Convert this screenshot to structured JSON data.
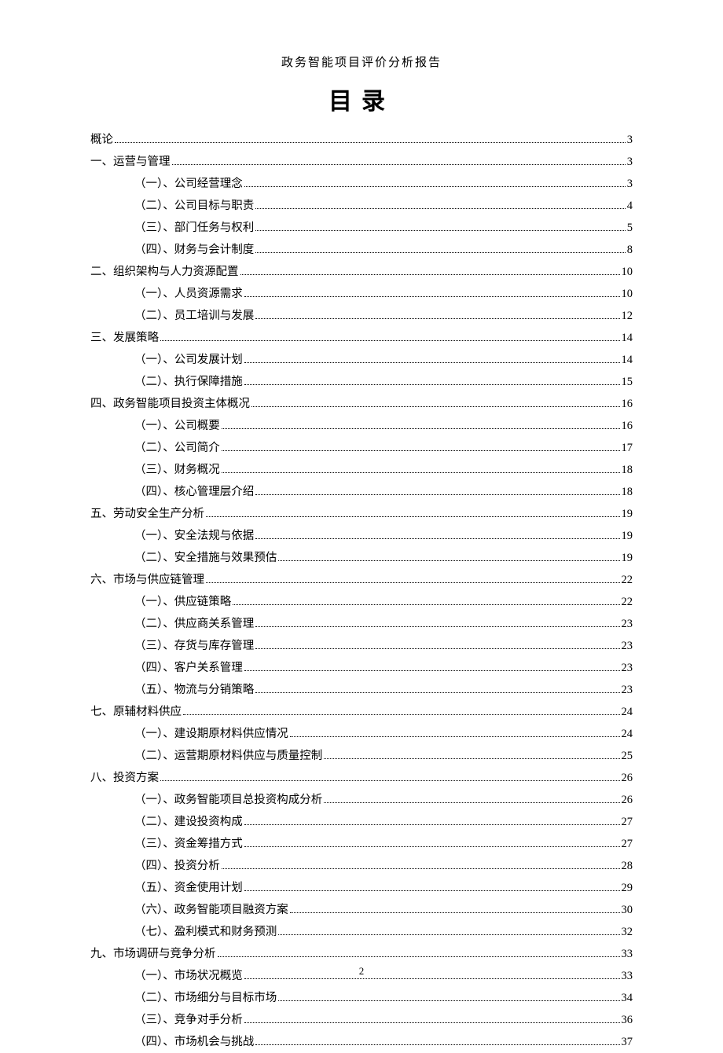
{
  "header": "政务智能项目评价分析报告",
  "title": "目录",
  "page_number": "2",
  "toc": [
    {
      "level": 0,
      "label": "概论",
      "page": "3"
    },
    {
      "level": 0,
      "label": "一、运营与管理",
      "page": "3"
    },
    {
      "level": 1,
      "label": "（一）、公司经营理念",
      "page": "3"
    },
    {
      "level": 1,
      "label": "（二）、公司目标与职责",
      "page": "4"
    },
    {
      "level": 1,
      "label": "（三）、部门任务与权利",
      "page": "5"
    },
    {
      "level": 1,
      "label": "（四）、财务与会计制度",
      "page": "8"
    },
    {
      "level": 0,
      "label": "二、组织架构与人力资源配置",
      "page": "10"
    },
    {
      "level": 1,
      "label": "（一）、人员资源需求",
      "page": "10"
    },
    {
      "level": 1,
      "label": "（二）、员工培训与发展",
      "page": "12"
    },
    {
      "level": 0,
      "label": "三、发展策略",
      "page": "14"
    },
    {
      "level": 1,
      "label": "（一）、公司发展计划",
      "page": "14"
    },
    {
      "level": 1,
      "label": "（二）、执行保障措施",
      "page": "15"
    },
    {
      "level": 0,
      "label": "四、政务智能项目投资主体概况",
      "page": "16"
    },
    {
      "level": 1,
      "label": "（一）、公司概要",
      "page": "16"
    },
    {
      "level": 1,
      "label": "（二）、公司简介",
      "page": "17"
    },
    {
      "level": 1,
      "label": "（三）、财务概况",
      "page": "18"
    },
    {
      "level": 1,
      "label": "（四）、核心管理层介绍",
      "page": "18"
    },
    {
      "level": 0,
      "label": "五、劳动安全生产分析",
      "page": "19"
    },
    {
      "level": 1,
      "label": "（一）、安全法规与依据",
      "page": "19"
    },
    {
      "level": 1,
      "label": "（二）、安全措施与效果预估",
      "page": "19"
    },
    {
      "level": 0,
      "label": "六、市场与供应链管理",
      "page": "22"
    },
    {
      "level": 1,
      "label": "（一）、供应链策略",
      "page": "22"
    },
    {
      "level": 1,
      "label": "（二）、供应商关系管理",
      "page": "23"
    },
    {
      "level": 1,
      "label": "（三）、存货与库存管理",
      "page": "23"
    },
    {
      "level": 1,
      "label": "（四）、客户关系管理",
      "page": "23"
    },
    {
      "level": 1,
      "label": "（五）、物流与分销策略",
      "page": "23"
    },
    {
      "level": 0,
      "label": "七、原辅材料供应",
      "page": "24"
    },
    {
      "level": 1,
      "label": "（一）、建设期原材料供应情况",
      "page": "24"
    },
    {
      "level": 1,
      "label": "（二）、运营期原材料供应与质量控制",
      "page": "25"
    },
    {
      "level": 0,
      "label": "八、投资方案",
      "page": "26"
    },
    {
      "level": 1,
      "label": "（一）、政务智能项目总投资构成分析",
      "page": "26"
    },
    {
      "level": 1,
      "label": "（二）、建设投资构成",
      "page": "27"
    },
    {
      "level": 1,
      "label": "（三）、资金筹措方式",
      "page": "27"
    },
    {
      "level": 1,
      "label": "（四）、投资分析",
      "page": "28"
    },
    {
      "level": 1,
      "label": "（五）、资金使用计划",
      "page": "29"
    },
    {
      "level": 1,
      "label": "（六）、政务智能项目融资方案",
      "page": "30"
    },
    {
      "level": 1,
      "label": "（七）、盈利模式和财务预测",
      "page": "32"
    },
    {
      "level": 0,
      "label": "九、市场调研与竞争分析",
      "page": "33"
    },
    {
      "level": 1,
      "label": "（一）、市场状况概览",
      "page": "33"
    },
    {
      "level": 1,
      "label": "（二）、市场细分与目标市场",
      "page": "34"
    },
    {
      "level": 1,
      "label": "（三）、竞争对手分析",
      "page": "36"
    },
    {
      "level": 1,
      "label": "（四）、市场机会与挑战",
      "page": "37"
    }
  ]
}
